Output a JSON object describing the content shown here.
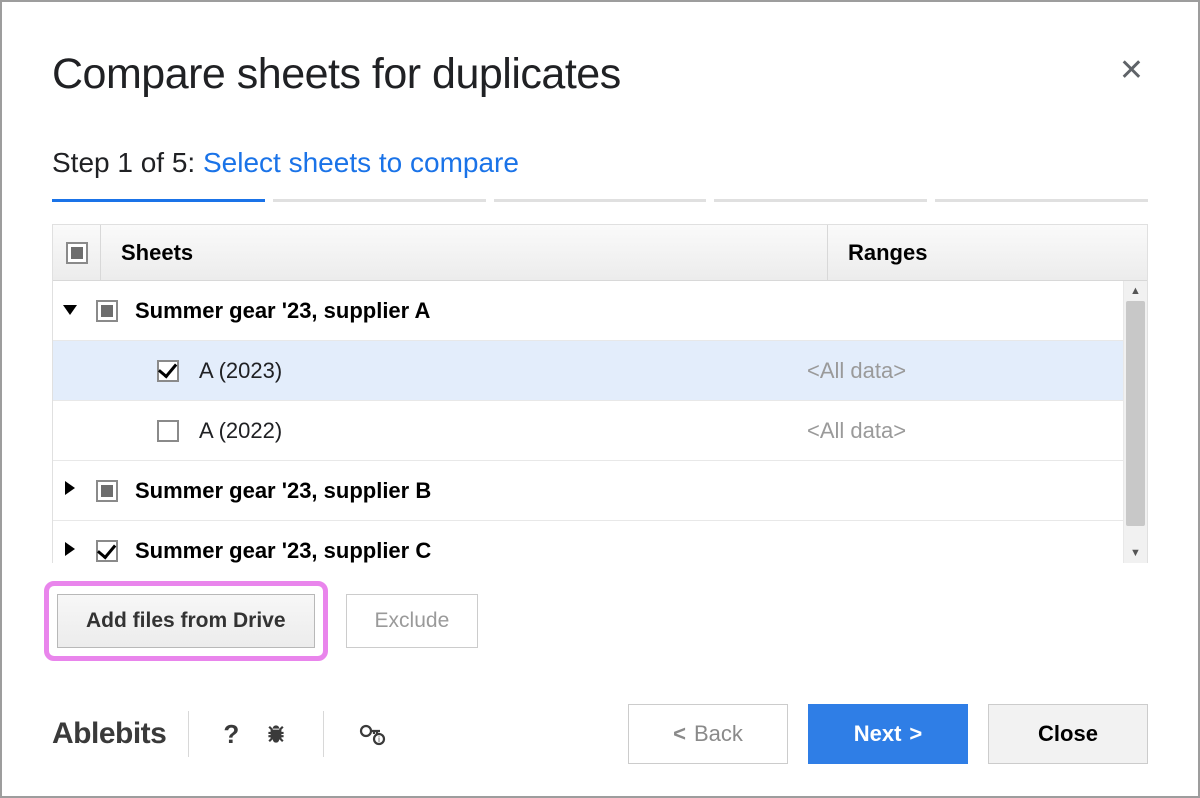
{
  "dialog": {
    "title": "Compare sheets for duplicates",
    "step_prefix": "Step 1 of 5: ",
    "step_action": "Select sheets to compare",
    "active_step": 1,
    "total_steps": 5
  },
  "table": {
    "header_sheets": "Sheets",
    "header_ranges": "Ranges",
    "groups": [
      {
        "name": "Summer gear '23, supplier A",
        "expanded": true,
        "check_state": "indeterminate",
        "children": [
          {
            "name": "A (2023)",
            "range": "<All data>",
            "checked": true,
            "selected": true
          },
          {
            "name": "A (2022)",
            "range": "<All data>",
            "checked": false,
            "selected": false
          }
        ]
      },
      {
        "name": "Summer gear '23, supplier B",
        "expanded": false,
        "check_state": "indeterminate",
        "children": []
      },
      {
        "name": "Summer gear '23, supplier C",
        "expanded": false,
        "check_state": "checked",
        "children": []
      }
    ]
  },
  "buttons": {
    "add_files": "Add files from Drive",
    "exclude": "Exclude",
    "back": "Back",
    "next": "Next",
    "close": "Close"
  },
  "footer": {
    "brand": "Ablebits"
  }
}
